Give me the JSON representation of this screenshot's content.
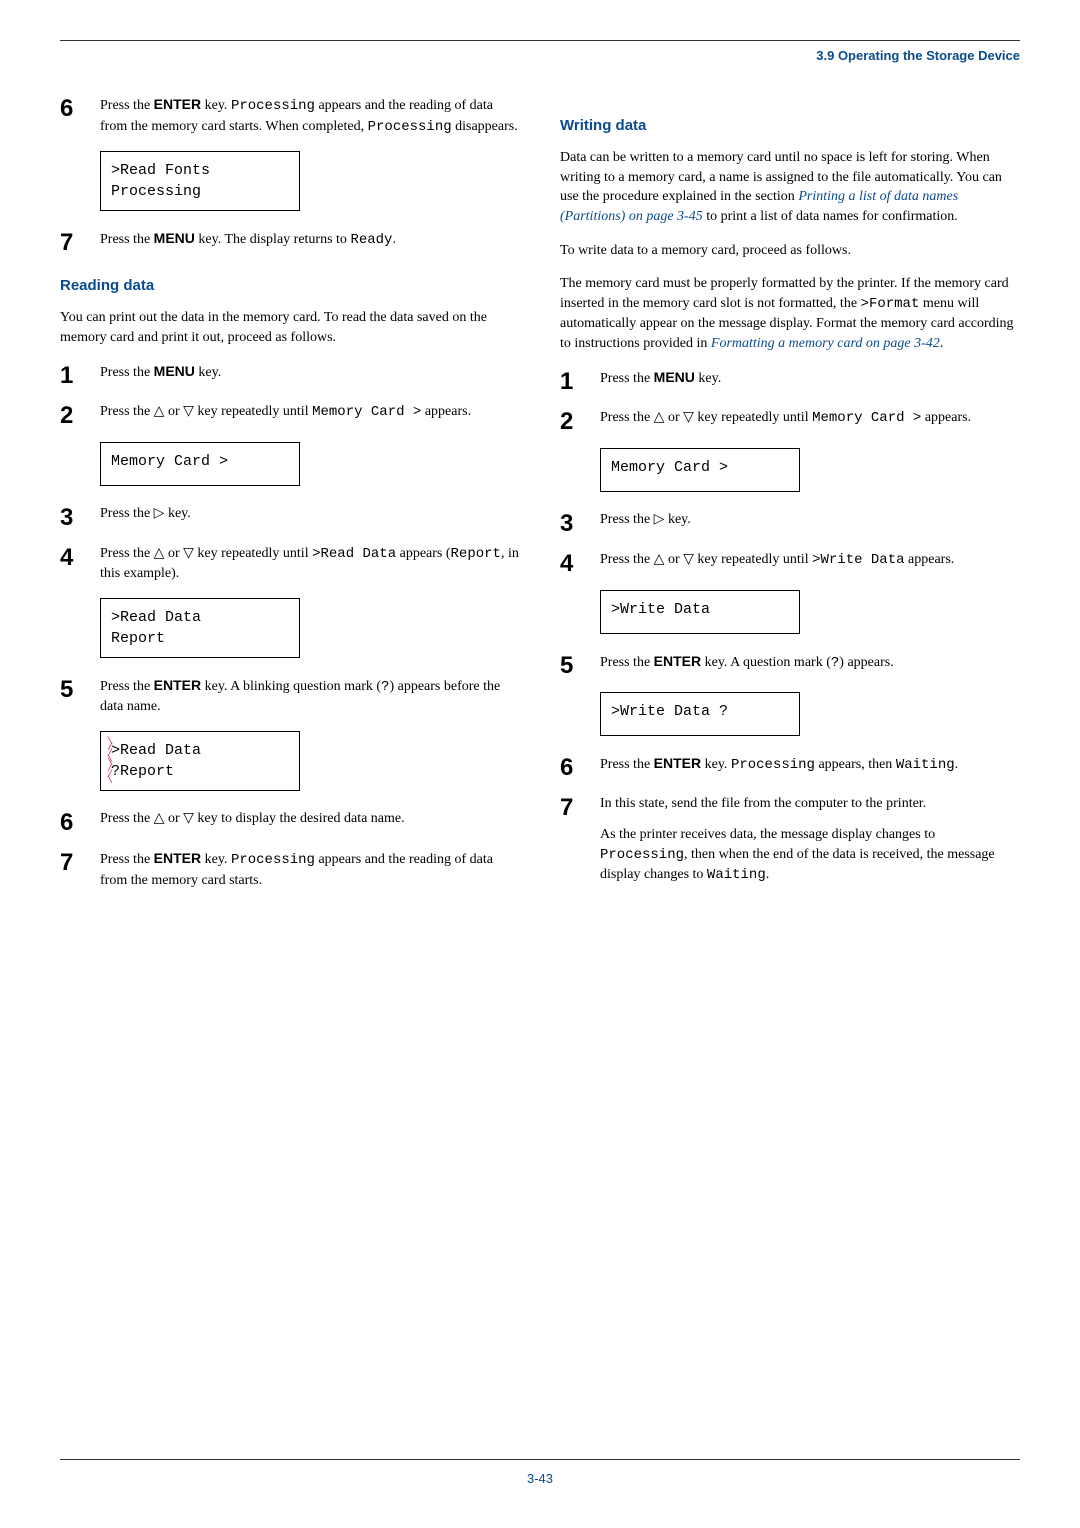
{
  "header": {
    "section_label": "3.9 Operating the Storage Device"
  },
  "left": {
    "step6": "Press the ENTER key. Processing appears and the reading of data from the memory card starts. When completed, Processing disappears.",
    "display1_line1": ">Read Fonts",
    "display1_line2": "Processing",
    "step7": "Press the MENU key. The display returns to Ready.",
    "heading_reading": "Reading data",
    "reading_intro": "You can print out the data in the memory card. To read the data saved on the memory card and print it out, proceed as follows.",
    "r_step1": "Press the MENU key.",
    "r_step2": "Press the △ or ▽ key repeatedly until Memory Card > appears.",
    "display2": "Memory Card     >",
    "r_step3": "Press the ▷ key.",
    "r_step4": "Press the △ or ▽ key repeatedly until >Read Data appears (Report, in this example).",
    "display3_line1": ">Read Data",
    "display3_line2": " Report",
    "r_step5": "Press the ENTER key. A blinking question mark (?) appears before the data name.",
    "display4_line1": ">Read Data",
    "display4_line2": "?Report",
    "r_step6": "Press the △ or ▽ key to display the desired data name.",
    "r_step7": "Press the ENTER key. Processing appears and the reading of data from the memory card starts."
  },
  "right": {
    "heading_writing": "Writing data",
    "writing_intro_a": "Data can be written to a memory card until no space is left for storing. When writing to a memory card, a name is assigned to the file automatically. You can use the procedure explained in the section ",
    "writing_link1": "Printing a list of data names (Partitions) on page 3-45",
    "writing_intro_b": " to print a list of data names for confirmation.",
    "writing_intro2": "To write data to a memory card, proceed as follows.",
    "writing_intro3_a": "The memory card must be properly formatted by the printer. If the memory card inserted in the memory card slot is not formatted, the >Format menu will automatically appear on the message display. Format the memory card according to instructions provided in ",
    "writing_link2": "Formatting a memory card on page 3-42",
    "writing_intro3_b": ".",
    "w_step1": "Press the MENU key.",
    "w_step2": "Press the △ or ▽ key repeatedly until Memory Card > appears.",
    "display5": "Memory Card     >",
    "w_step3": "Press the ▷ key.",
    "w_step4": "Press the △ or ▽ key repeatedly until >Write Data appears.",
    "display6": ">Write Data",
    "w_step5": "Press the ENTER key. A question mark (?) appears.",
    "display7": ">Write Data ?",
    "w_step6": "Press the ENTER key. Processing appears, then Waiting.",
    "w_step7": "In this state, send the file from the computer to the printer.",
    "w_step7b": "As the printer receives data, the message display changes to Processing, then when the end of the data is received, the message display changes to Waiting."
  },
  "footer": {
    "page": "3-43"
  }
}
